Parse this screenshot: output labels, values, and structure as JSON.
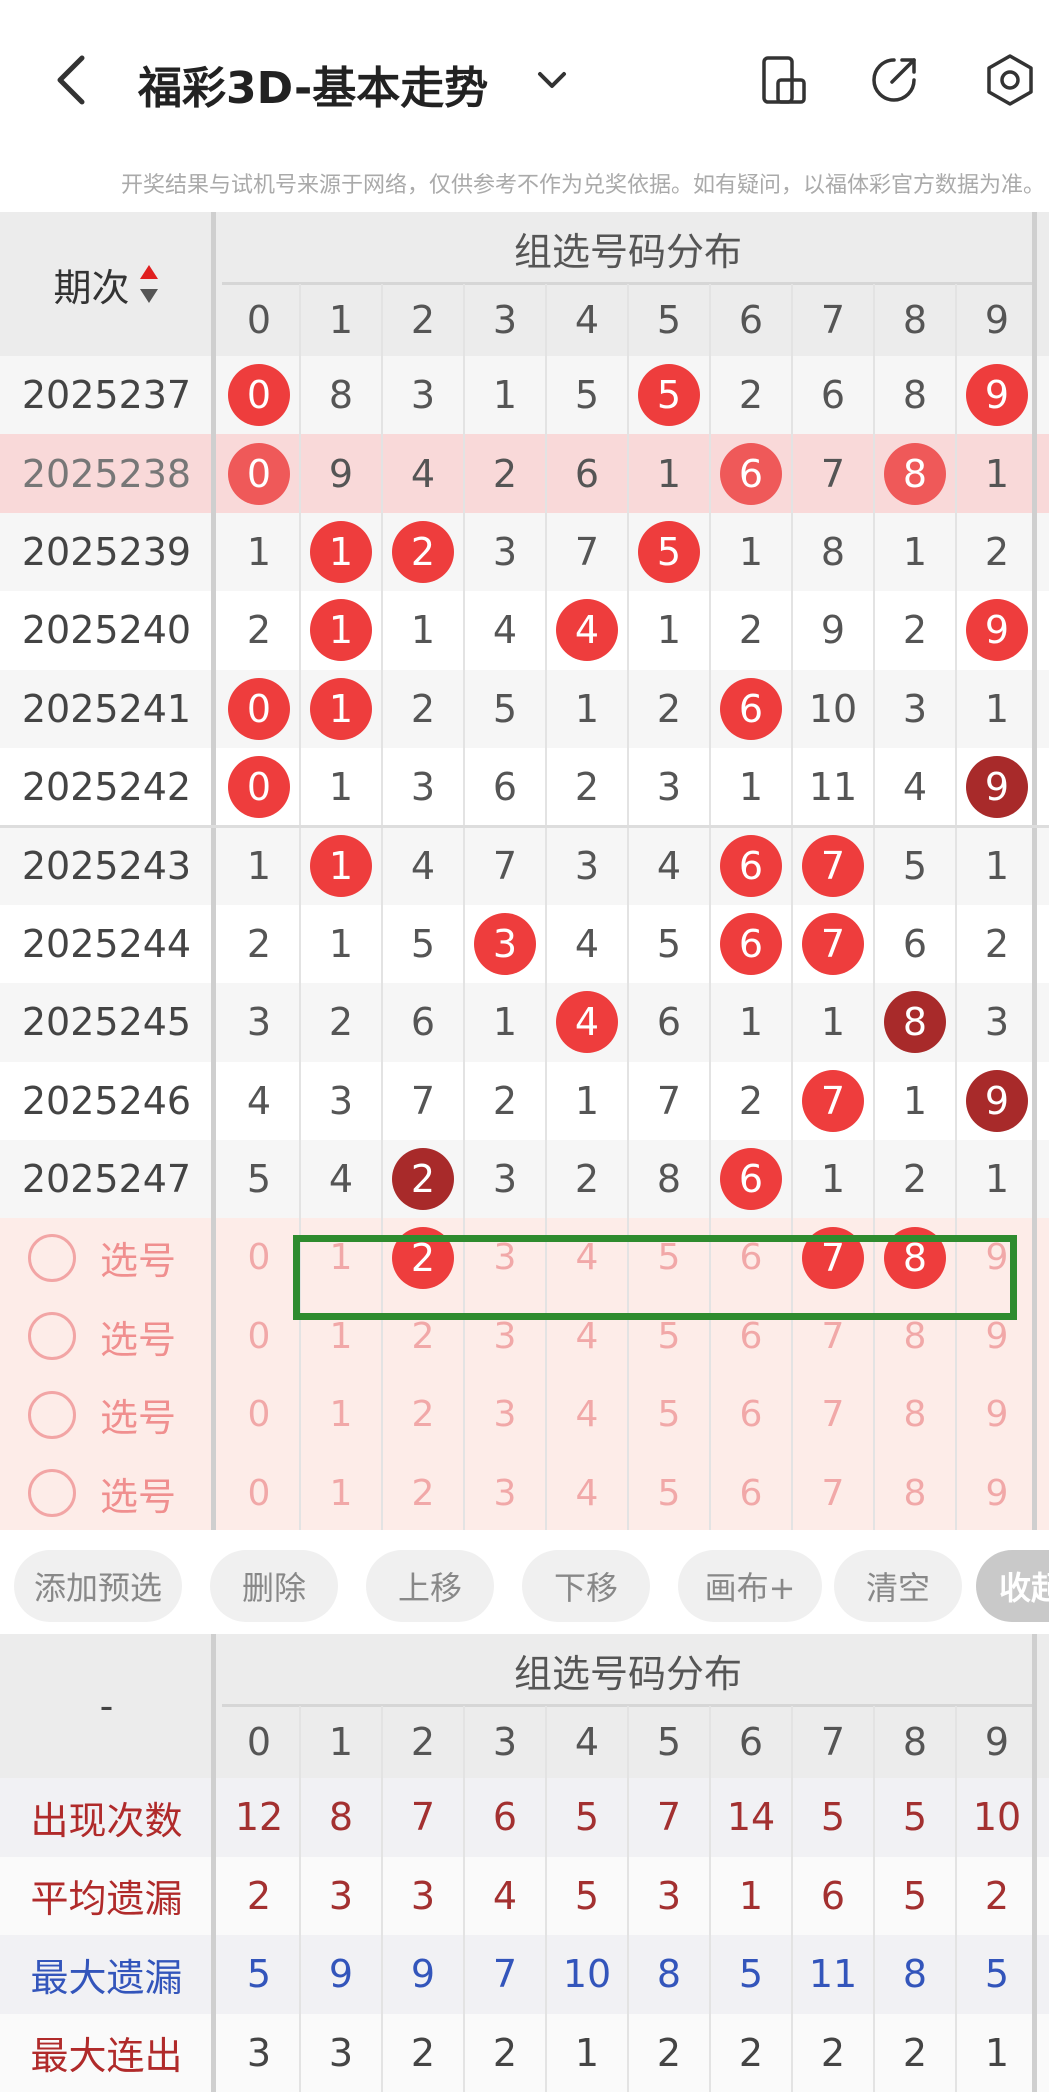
{
  "header": {
    "title": "福彩3D-基本走势",
    "icons": [
      "back-icon",
      "chevron-down-icon",
      "phone-rotate-icon",
      "share-icon",
      "settings-icon"
    ]
  },
  "notice": "开奖结果与试机号来源于网络，仅供参考不作为兑奖依据。如有疑问，以福体彩官方数据为准。",
  "main_table": {
    "issue_header": "期次",
    "group_header": "组选号码分布",
    "digit_headers": [
      "0",
      "1",
      "2",
      "3",
      "4",
      "5",
      "6",
      "7",
      "8",
      "9"
    ],
    "rows": [
      {
        "issue": "2025237",
        "cells": [
          "0",
          "8",
          "3",
          "1",
          "5",
          "5",
          "2",
          "6",
          "8",
          "9"
        ],
        "hits": [
          0,
          5,
          9
        ],
        "dark": [],
        "highlight": false
      },
      {
        "issue": "2025238",
        "cells": [
          "0",
          "9",
          "4",
          "2",
          "6",
          "1",
          "6",
          "7",
          "8",
          "1"
        ],
        "hits": [
          0,
          6,
          8
        ],
        "dark": [],
        "highlight": true
      },
      {
        "issue": "2025239",
        "cells": [
          "1",
          "1",
          "2",
          "3",
          "7",
          "5",
          "1",
          "8",
          "1",
          "2"
        ],
        "hits": [
          1,
          2,
          5
        ],
        "dark": [],
        "highlight": false
      },
      {
        "issue": "2025240",
        "cells": [
          "2",
          "1",
          "1",
          "4",
          "4",
          "1",
          "2",
          "9",
          "2",
          "9"
        ],
        "hits": [
          1,
          4,
          9
        ],
        "dark": [],
        "highlight": false
      },
      {
        "issue": "2025241",
        "cells": [
          "0",
          "1",
          "2",
          "5",
          "1",
          "2",
          "6",
          "10",
          "3",
          "1"
        ],
        "hits": [
          0,
          1,
          6
        ],
        "dark": [],
        "highlight": false
      },
      {
        "issue": "2025242",
        "cells": [
          "0",
          "1",
          "3",
          "6",
          "2",
          "3",
          "1",
          "11",
          "4",
          "9"
        ],
        "hits": [
          0,
          9
        ],
        "dark": [
          9
        ],
        "highlight": false
      },
      {
        "issue": "2025243",
        "cells": [
          "1",
          "1",
          "4",
          "7",
          "3",
          "4",
          "6",
          "7",
          "5",
          "1"
        ],
        "hits": [
          1,
          6,
          7
        ],
        "dark": [],
        "highlight": false
      },
      {
        "issue": "2025244",
        "cells": [
          "2",
          "1",
          "5",
          "3",
          "4",
          "5",
          "6",
          "7",
          "6",
          "2"
        ],
        "hits": [
          3,
          6,
          7
        ],
        "dark": [],
        "highlight": false
      },
      {
        "issue": "2025245",
        "cells": [
          "3",
          "2",
          "6",
          "1",
          "4",
          "6",
          "1",
          "1",
          "8",
          "3"
        ],
        "hits": [
          4,
          8
        ],
        "dark": [
          8
        ],
        "highlight": false
      },
      {
        "issue": "2025246",
        "cells": [
          "4",
          "3",
          "7",
          "2",
          "1",
          "7",
          "2",
          "7",
          "1",
          "9"
        ],
        "hits": [
          7,
          9
        ],
        "dark": [
          9
        ],
        "highlight": false
      },
      {
        "issue": "2025247",
        "cells": [
          "5",
          "4",
          "2",
          "3",
          "2",
          "8",
          "6",
          "1",
          "2",
          "1"
        ],
        "hits": [
          2,
          6
        ],
        "dark": [
          2
        ],
        "highlight": false
      }
    ],
    "pick_rows": [
      {
        "label": "选号",
        "digits": [
          "0",
          "1",
          "2",
          "3",
          "4",
          "5",
          "6",
          "7",
          "8",
          "9"
        ],
        "selected": [
          2,
          7,
          8
        ]
      },
      {
        "label": "选号",
        "digits": [
          "0",
          "1",
          "2",
          "3",
          "4",
          "5",
          "6",
          "7",
          "8",
          "9"
        ],
        "selected": []
      },
      {
        "label": "选号",
        "digits": [
          "0",
          "1",
          "2",
          "3",
          "4",
          "5",
          "6",
          "7",
          "8",
          "9"
        ],
        "selected": []
      },
      {
        "label": "选号",
        "digits": [
          "0",
          "1",
          "2",
          "3",
          "4",
          "5",
          "6",
          "7",
          "8",
          "9"
        ],
        "selected": []
      }
    ]
  },
  "buttons": [
    "添加预选",
    "删除",
    "上移",
    "下移",
    "画布+",
    "清空",
    "收起"
  ],
  "stats_table": {
    "corner": "-",
    "group_header": "组选号码分布",
    "digit_headers": [
      "0",
      "1",
      "2",
      "3",
      "4",
      "5",
      "6",
      "7",
      "8",
      "9"
    ],
    "rows": [
      {
        "label": "出现次数",
        "values": [
          "12",
          "8",
          "7",
          "6",
          "5",
          "7",
          "14",
          "5",
          "5",
          "10"
        ],
        "style": "red"
      },
      {
        "label": "平均遗漏",
        "values": [
          "2",
          "3",
          "3",
          "4",
          "5",
          "3",
          "1",
          "6",
          "5",
          "2"
        ],
        "style": "red"
      },
      {
        "label": "最大遗漏",
        "values": [
          "5",
          "9",
          "9",
          "7",
          "10",
          "8",
          "5",
          "11",
          "8",
          "5"
        ],
        "style": "blue"
      },
      {
        "label": "最大连出",
        "values": [
          "3",
          "3",
          "2",
          "2",
          "1",
          "2",
          "2",
          "2",
          "2",
          "1"
        ],
        "style": "dark"
      }
    ]
  },
  "colors": {
    "hit": "#ee3d3d",
    "hit_dark": "#a82a2a",
    "highlight_row": "#f9d9d9",
    "pick_bg": "#fdece8",
    "select_box": "#2e8b2e"
  }
}
